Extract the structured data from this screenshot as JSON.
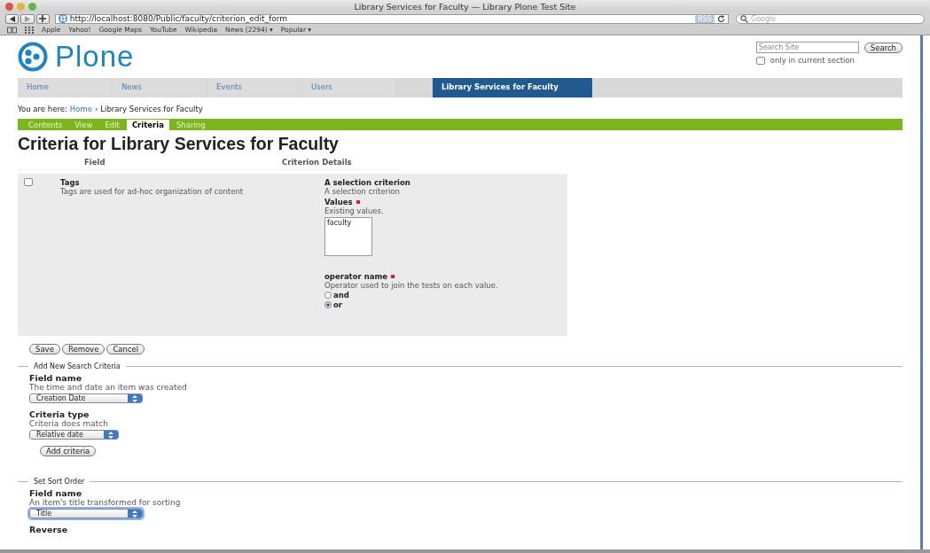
{
  "browser": {
    "title": "Library Services for Faculty — Library Plone Test Site",
    "url": "http://localhost:8080/Public/faculty/criterion_edit_form",
    "rss": "RSS",
    "search_placeholder": "Google",
    "bookmarks": [
      "Apple",
      "Yahoo!",
      "Google Maps",
      "YouTube",
      "Wikipedia",
      "News (2294) ▾",
      "Popular ▾"
    ]
  },
  "site": {
    "logo": "Plone",
    "search_placeholder": "Search Site",
    "search_button": "Search",
    "only_current": {
      "label": "only in current section",
      "checked": false
    }
  },
  "nav": [
    {
      "label": "Home",
      "selected": false
    },
    {
      "label": "News",
      "selected": false
    },
    {
      "label": "Events",
      "selected": false
    },
    {
      "label": "Users",
      "selected": false
    },
    {
      "label": "Library Services for Faculty",
      "selected": true
    }
  ],
  "breadcrumb": {
    "prefix": "You are here:",
    "home": "Home",
    "separator": "›",
    "current": "Library Services for Faculty"
  },
  "content_tabs": [
    {
      "label": "Contents",
      "selected": false
    },
    {
      "label": "View",
      "selected": false
    },
    {
      "label": "Edit",
      "selected": false
    },
    {
      "label": "Criteria",
      "selected": true
    },
    {
      "label": "Sharing",
      "selected": false
    }
  ],
  "heading": "Criteria for Library Services for Faculty",
  "table": {
    "columns": [
      "Field",
      "Criterion Details"
    ],
    "rows": [
      {
        "checked": false,
        "field": "Tags",
        "field_desc": "Tags are used for ad-hoc organization of content",
        "title": "A selection criterion",
        "subtitle": "A selection criterion",
        "values_label": "Values",
        "values_hint": "Existing values.",
        "values": [
          "faculty"
        ],
        "operator_label": "operator name",
        "operator_hint": "Operator used to join the tests on each value.",
        "options": [
          {
            "label": "and",
            "selected": false
          },
          {
            "label": "or",
            "selected": true
          }
        ]
      }
    ]
  },
  "buttons": [
    "Save",
    "Remove",
    "Cancel"
  ],
  "add_new": {
    "legend": "Add New Search Criteria",
    "fields": [
      {
        "label": "Field name",
        "hint": "The time and date an item was created",
        "value": "Creation Date"
      },
      {
        "label": "Criteria type",
        "hint": "Criteria does match",
        "value": "Relative date"
      }
    ],
    "button": "Add criteria"
  },
  "sort": {
    "legend": "Set Sort Order",
    "field": {
      "label": "Field name",
      "hint": "An item's title transformed for sorting",
      "value": "Title"
    },
    "reverse": "Reverse"
  }
}
